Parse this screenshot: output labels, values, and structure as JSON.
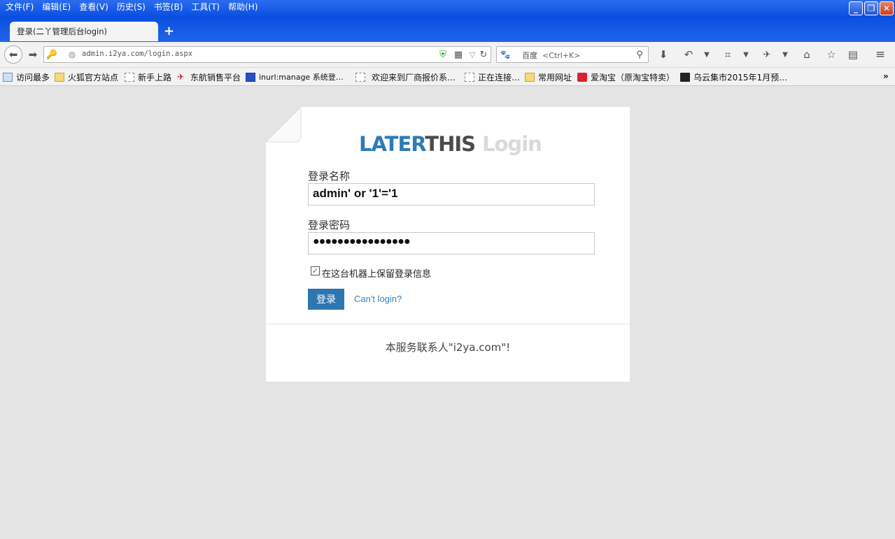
{
  "menu": [
    "文件(F)",
    "编辑(E)",
    "查看(V)",
    "历史(S)",
    "书签(B)",
    "工具(T)",
    "帮助(H)"
  ],
  "window_controls": {
    "minimize": "_",
    "restore": "❐",
    "close": "✕"
  },
  "tab": {
    "title": "登录(二丫管理后台login)",
    "new_tab": "+"
  },
  "address": {
    "url": "admin.i2ya.com/login.aspx"
  },
  "search": {
    "engine": "百度",
    "placeholder": "<Ctrl+K>"
  },
  "bookmarks": [
    {
      "label": "访问最多",
      "icon": "search-page-icon"
    },
    {
      "label": "火狐官方站点",
      "icon": "folder-icon"
    },
    {
      "label": "新手上路",
      "icon": "page-icon"
    },
    {
      "label": "东航销售平台",
      "icon": "airline-icon"
    },
    {
      "label": "inurl:manage 系统登…",
      "icon": "baidu-icon"
    },
    {
      "label": "欢迎来到厂商报价系…",
      "icon": "page-icon"
    },
    {
      "label": "正在连接…",
      "icon": "page-icon"
    },
    {
      "label": "常用网址",
      "icon": "folder-icon"
    },
    {
      "label": "爱淘宝（原淘宝特卖）",
      "icon": "taobao-icon"
    },
    {
      "label": "乌云集市2015年1月预…",
      "icon": "wooyun-icon"
    }
  ],
  "login": {
    "logo_part1": "LATER",
    "logo_part2": "THIS",
    "logo_part3": "Login",
    "username_label": "登录名称",
    "username_value": "admin' or '1'='1",
    "password_label": "登录密码",
    "password_value": "●●●●●●●●●●●●●●●●",
    "remember_label": "在这台机器上保留登录信息",
    "remember_checked": true,
    "submit_label": "登录",
    "cant_login": "Can't login?",
    "footer": "本服务联系人\"i2ya.com\"!"
  },
  "colors": {
    "brand_blue": "#2d7bb6",
    "button": "#2d76b0",
    "titlebar": "#0a4fe0"
  }
}
